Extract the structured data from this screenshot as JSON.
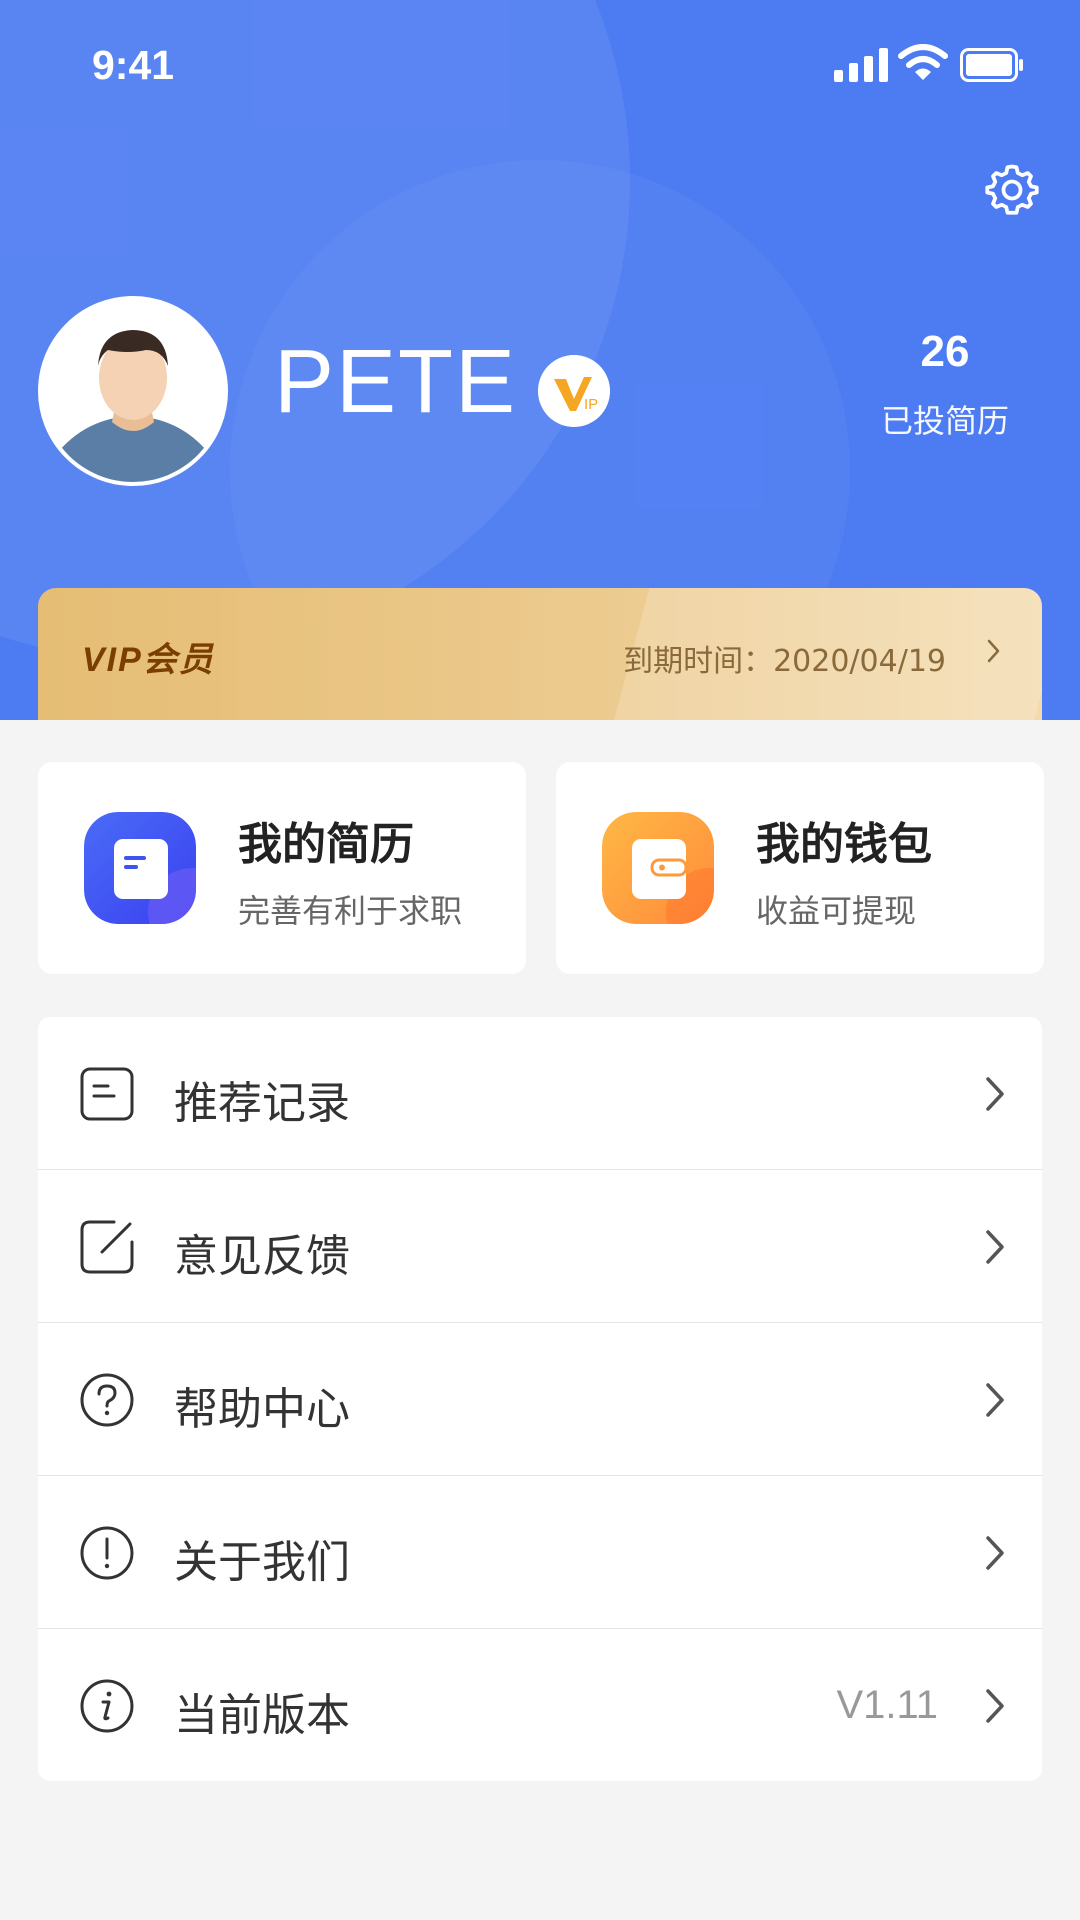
{
  "status_bar": {
    "time": "9:41"
  },
  "profile": {
    "name": "PETE",
    "stat_count": "26",
    "stat_label": "已投简历"
  },
  "vip": {
    "title": "VIP会员",
    "expire": "到期时间：2020/04/19"
  },
  "quick_actions": [
    {
      "title": "我的简历",
      "subtitle": "完善有利于求职",
      "icon": "resume-icon",
      "color": "#3d55f0"
    },
    {
      "title": "我的钱包",
      "subtitle": "收益可提现",
      "icon": "wallet-icon",
      "color": "#ff9a3c"
    }
  ],
  "menu": [
    {
      "label": "推荐记录",
      "icon": "document-icon"
    },
    {
      "label": "意见反馈",
      "icon": "edit-icon"
    },
    {
      "label": "帮助中心",
      "icon": "question-icon"
    },
    {
      "label": "关于我们",
      "icon": "exclamation-icon"
    },
    {
      "label": "当前版本",
      "icon": "info-icon",
      "value": "V1.11"
    }
  ],
  "colors": {
    "primary": "#4d7cf2",
    "vip_gold": "#e5bd74",
    "vip_text": "#7a3f00"
  }
}
